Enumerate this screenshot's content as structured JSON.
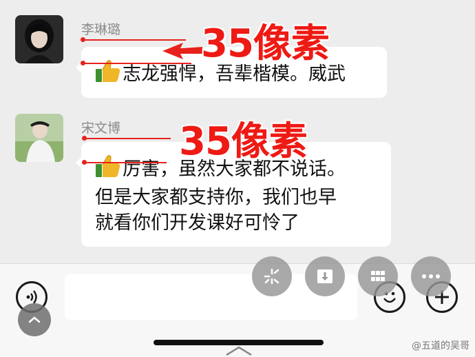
{
  "messages": [
    {
      "name": "李琳璐",
      "text": "志龙强悍，吾辈楷模。威武",
      "annotation": "35像素"
    },
    {
      "name": "宋文博",
      "text_lines": [
        "厉害，虽然大家都不说话。",
        "但是大家都支持你，我们也早",
        "就看你们开发课好可怜了"
      ],
      "annotation": "35像素"
    }
  ],
  "input": {
    "value": ""
  },
  "watermark": "@五道的吴哥",
  "icons": {
    "voice": "voice-icon",
    "emoji": "emoji-icon",
    "plus": "plus-icon",
    "floating": [
      "sparkle-icon",
      "download-icon",
      "grid-icon",
      "more-icon",
      "collapse-icon"
    ],
    "thumb": "thumbs-up-icon"
  },
  "colors": {
    "annotation": "#ee1a14",
    "bubble": "#ffffff",
    "background": "#ededed"
  }
}
